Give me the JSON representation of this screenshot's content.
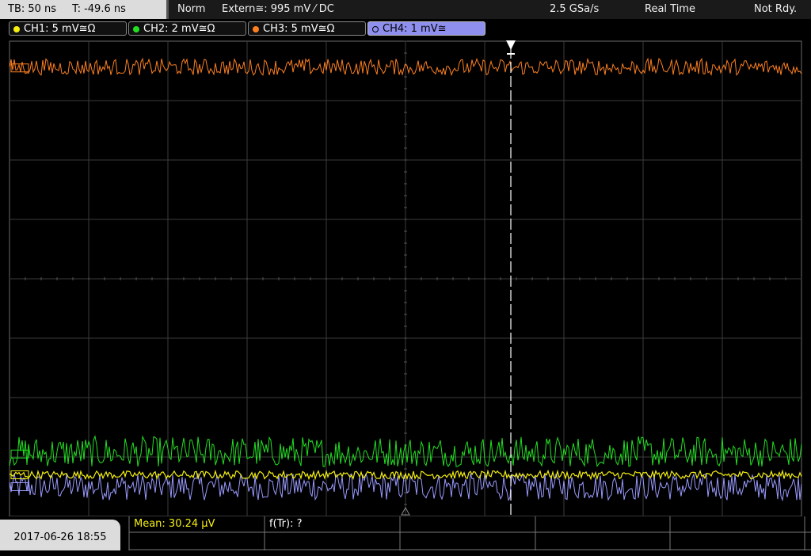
{
  "status_bar": {
    "timebase": "TB: 50 ns",
    "trigger_time": "T: -49.6 ns",
    "trigger_mode": "Norm",
    "trigger_source": "Extern≅: 995 mV ⁄ DC",
    "sample_rate": "2.5 GSa/s",
    "acquisition_mode": "Real Time",
    "status": "Not Rdy."
  },
  "channels": [
    {
      "label": "CH1: 5 mV≅Ω",
      "color": "#f5f010"
    },
    {
      "label": "CH2: 2 mV≅Ω",
      "color": "#22e022"
    },
    {
      "label": "CH3: 5 mV≅Ω",
      "color": "#ff8020"
    },
    {
      "label": "CH4: 1 mV≅",
      "color": "#9a9aff"
    }
  ],
  "waveforms": {
    "ch3_level_div": 3.55,
    "ch2_level_div": -2.95,
    "ch1_level_div": -3.3,
    "ch4_level_div": -3.5,
    "trigger_position_div": 1.33
  },
  "measurements": {
    "mean": "Mean: 30.24 µV",
    "frequency": "f(Tr): ?"
  },
  "datetime": "2017-06-26 18:55"
}
